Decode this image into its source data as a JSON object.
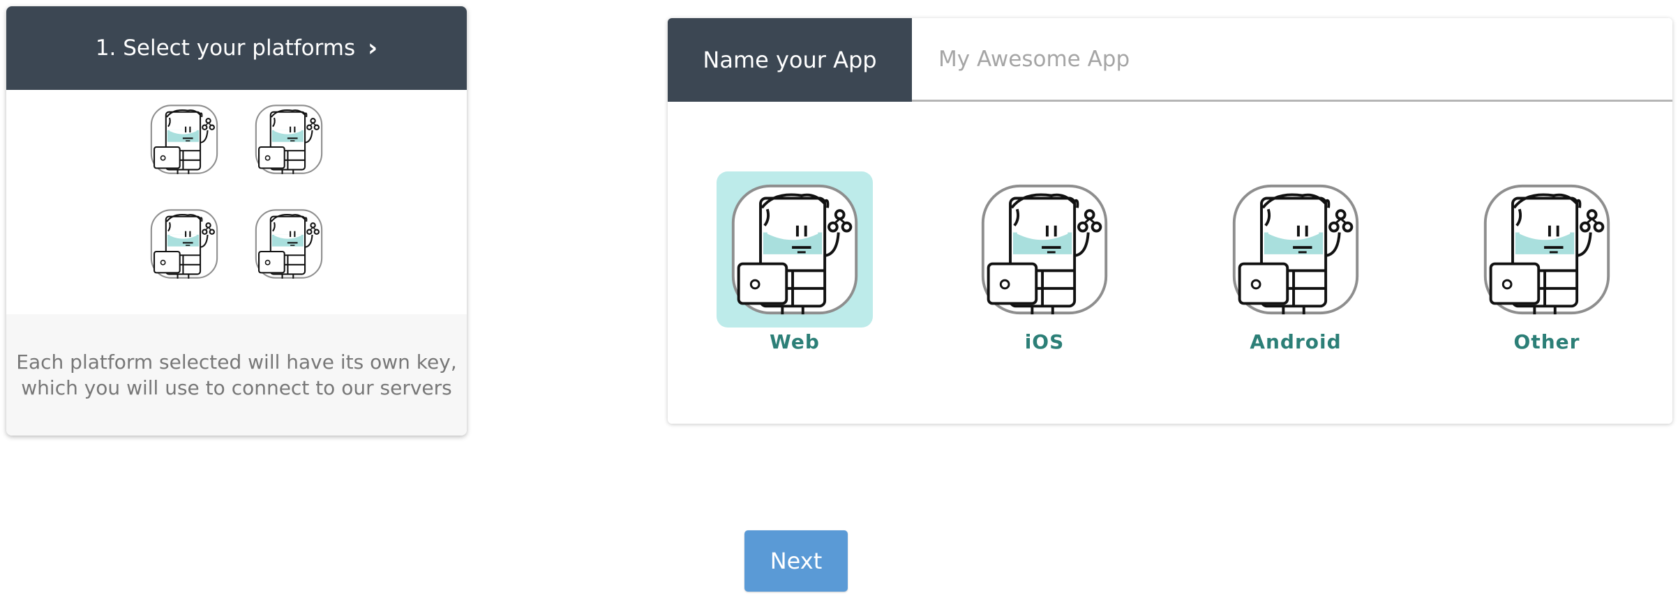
{
  "step": {
    "title": "1. Select your platforms",
    "chevron_icon": "chevron-right-icon",
    "description_line1": "Each platform selected will have its own key,",
    "description_line2": "which you will use to connect to our servers"
  },
  "app_name": {
    "label": "Name your App",
    "placeholder": "My Awesome App",
    "value": ""
  },
  "platforms": [
    {
      "label": "Web",
      "selected": true,
      "icon": "device-character-icon"
    },
    {
      "label": "iOS",
      "selected": false,
      "icon": "device-character-icon"
    },
    {
      "label": "Android",
      "selected": false,
      "icon": "device-character-icon"
    },
    {
      "label": "Other",
      "selected": false,
      "icon": "device-character-icon"
    }
  ],
  "actions": {
    "next_label": "Next"
  },
  "colors": {
    "header_bg": "#3c4753",
    "selected_tile": "#bdebea",
    "label_teal": "#2c7f77",
    "button_blue": "#5a9ad6"
  }
}
